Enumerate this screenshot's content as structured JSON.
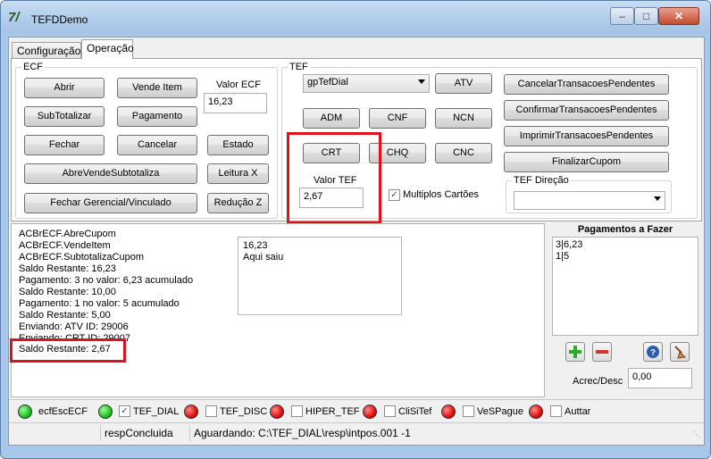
{
  "window": {
    "title": "TEFDDemo"
  },
  "tabs": [
    {
      "label": "Configuração"
    },
    {
      "label": "Operação"
    }
  ],
  "ecf": {
    "legend": "ECF",
    "buttons": {
      "abrir": "Abrir",
      "vende_item": "Vende Item",
      "subtotalizar": "SubTotalizar",
      "pagamento": "Pagamento",
      "fechar": "Fechar",
      "cancelar": "Cancelar",
      "estado": "Estado",
      "abre_vende_subtotaliza": "AbreVendeSubtotaliza",
      "leitura_x": "Leitura X",
      "fechar_gerencial": "Fechar Gerencial/Vinculado",
      "reducao_z": "Redução Z"
    },
    "valor_label": "Valor ECF",
    "valor_value": "16,23"
  },
  "tef": {
    "legend": "TEF",
    "gp_select": "gpTefDial",
    "buttons": {
      "atv": "ATV",
      "adm": "ADM",
      "cnf": "CNF",
      "ncn": "NCN",
      "crt": "CRT",
      "chq": "CHQ",
      "cnc": "CNC",
      "cancelar_pendentes": "CancelarTransacoesPendentes",
      "confirmar_pendentes": "ConfirmarTransacoesPendentes",
      "imprimir_pendentes": "ImprimirTransacoesPendentes",
      "finalizar_cupom": "FinalizarCupom"
    },
    "valor_label": "Valor TEF",
    "valor_value": "2,67",
    "multiplos_cartoes": "Multiplos Cartões",
    "direcao_legend": "TEF Direção",
    "direcao_value": ""
  },
  "log": {
    "lines": [
      "ACBrECF.AbreCupom",
      "ACBrECF.VendeItem",
      "ACBrECF.SubtotalizaCupom",
      "Saldo Restante: 16,23",
      "Pagamento: 3 no valor: 6,23 acumulado",
      "Saldo Restante: 10,00",
      "Pagamento: 1 no valor: 5 acumulado",
      "Saldo Restante: 5,00",
      "Enviando: ATV ID: 29006",
      "Enviando: CRT ID: 29007",
      "Saldo Restante: 2,67"
    ]
  },
  "memo": {
    "lines": [
      "16,23",
      "Aqui saiu"
    ]
  },
  "pagamentos": {
    "title": "Pagamentos a Fazer",
    "items": [
      "3|6,23",
      "1|5"
    ],
    "acrec_label": "Acrec/Desc",
    "acrec_value": "0,00"
  },
  "indicators": [
    {
      "label": "ecfEscECF",
      "status": "green",
      "has_check": false,
      "checked": false
    },
    {
      "label": "TEF_DIAL",
      "status": "green",
      "has_check": true,
      "checked": true
    },
    {
      "label": "TEF_DISC",
      "status": "red",
      "has_check": true,
      "checked": false
    },
    {
      "label": "HIPER_TEF",
      "status": "red",
      "has_check": true,
      "checked": false
    },
    {
      "label": "CliSiTef",
      "status": "red",
      "has_check": true,
      "checked": false
    },
    {
      "label": "VeSPague",
      "status": "red",
      "has_check": true,
      "checked": false
    },
    {
      "label": "Auttar",
      "status": "red",
      "has_check": true,
      "checked": false
    }
  ],
  "statusbar": {
    "cell1": "",
    "cell2": "respConcluida",
    "cell3": "Aguardando: C:\\TEF_DIAL\\resp\\intpos.001 -1"
  },
  "icons": {
    "add": "plus-icon",
    "remove": "minus-icon",
    "help": "help-icon",
    "clear": "broom-icon"
  },
  "colors": {
    "highlight": "#e0101c",
    "status_green": "#1ec21e",
    "status_red": "#e01010"
  }
}
